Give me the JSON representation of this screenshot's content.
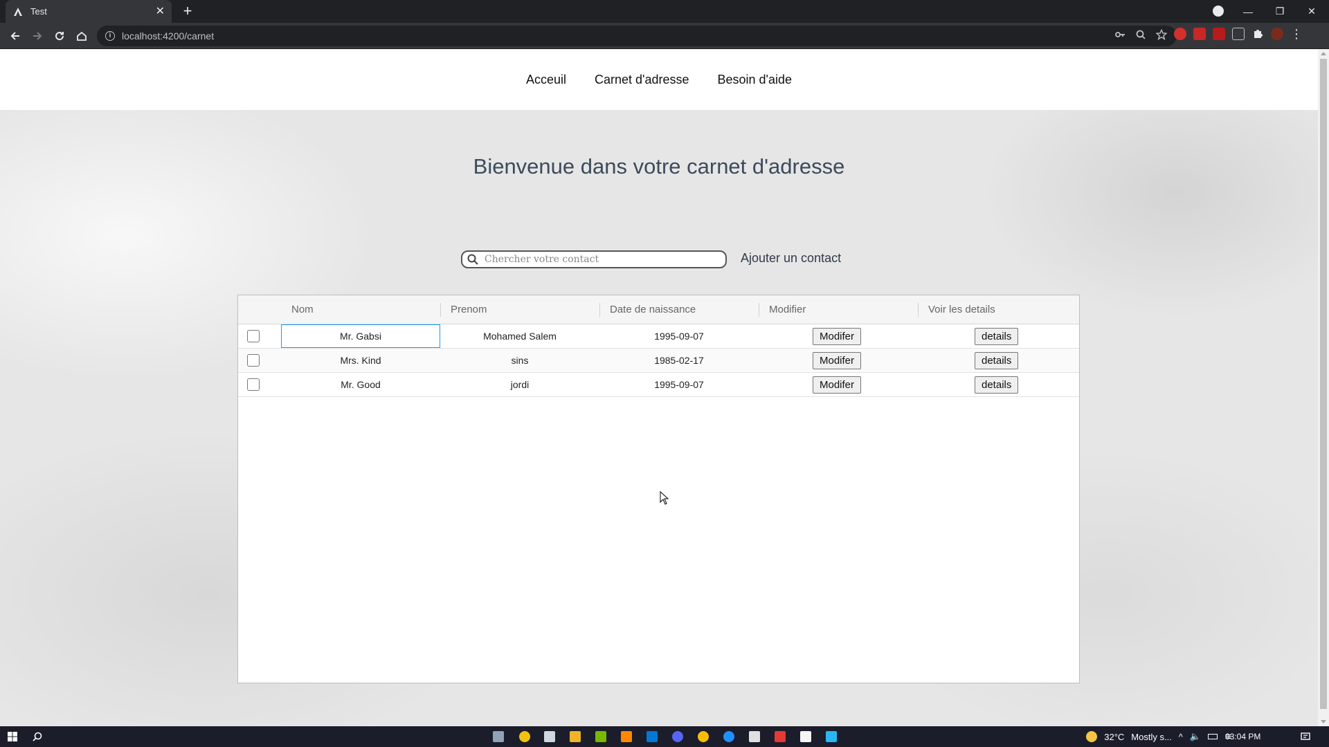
{
  "browser": {
    "tab_title": "Test",
    "tab_favicon_letter": "A",
    "url": "localhost:4200/carnet"
  },
  "nav": {
    "items": [
      {
        "label": "Acceuil"
      },
      {
        "label": "Carnet d'adresse"
      },
      {
        "label": "Besoin d'aide"
      }
    ]
  },
  "main": {
    "heading": "Bienvenue dans votre carnet d'adresse",
    "search_placeholder": "Chercher votre contact",
    "add_contact_label": "Ajouter un contact"
  },
  "grid": {
    "columns": [
      "Nom",
      "Prenom",
      "Date de naissance",
      "Modifier",
      "Voir les details"
    ],
    "rows": [
      {
        "nom": "Mr. Gabsi",
        "prenom": "Mohamed Salem",
        "date": "1995-09-07",
        "modifier": "Modifer",
        "details": "details"
      },
      {
        "nom": "Mrs. Kind",
        "prenom": "sins",
        "date": "1985-02-17",
        "modifier": "Modifer",
        "details": "details"
      },
      {
        "nom": "Mr. Good",
        "prenom": "jordi",
        "date": "1995-09-07",
        "modifier": "Modifer",
        "details": "details"
      }
    ]
  },
  "taskbar": {
    "weather": "32°C",
    "weather_desc": "Mostly s...",
    "time": "03:04 PM"
  },
  "colors": {
    "heading": "#3d4a5c",
    "focus_border": "#2196f3",
    "chrome_dark": "#202124",
    "chrome_toolbar": "#35363a"
  }
}
